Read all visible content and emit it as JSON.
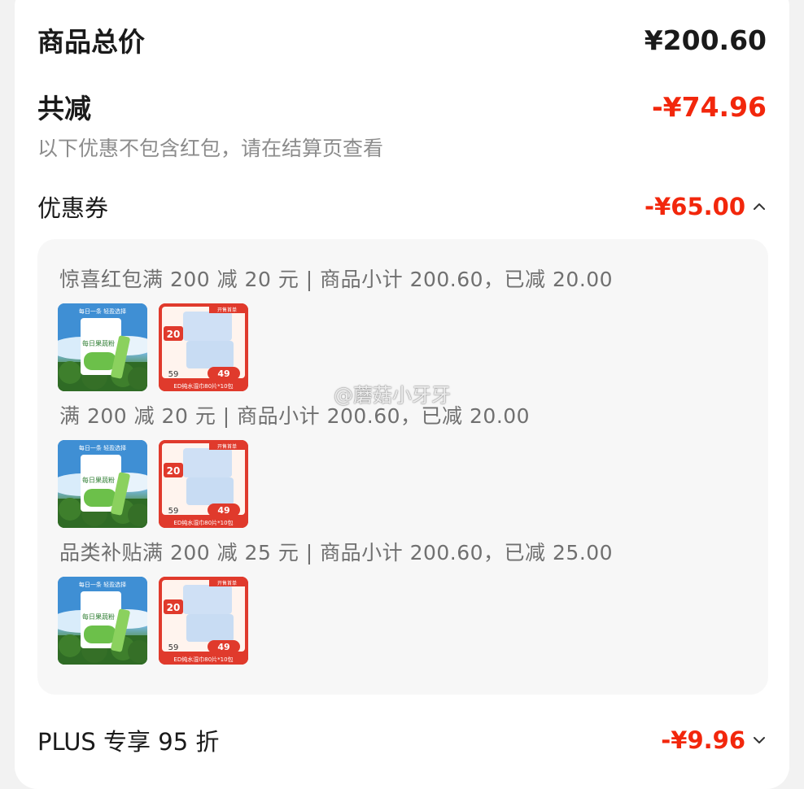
{
  "summary": {
    "total_label": "商品总价",
    "total_value": "¥200.60",
    "discount_label": "共减",
    "discount_value": "-¥74.96",
    "note": "以下优惠不包含红包，请在结算页查看"
  },
  "coupon_section": {
    "label": "优惠券",
    "value": "-¥65.00",
    "expanded_icon": "chevron-up-icon"
  },
  "coupons": [
    {
      "text": "惊喜红包满 200 减 20 元 | 商品小计 200.60，已减 20.00"
    },
    {
      "text": "满 200 减 20 元 | 商品小计 200.60，已减 20.00"
    },
    {
      "text": "品类补贴满 200 减 25 元 | 商品小计 200.60，已减 25.00"
    }
  ],
  "product_images": {
    "item1": {
      "top_text": "每日一条 轻盈选择",
      "bottom_text": "每日果蔬粉"
    },
    "item2": {
      "corner_tag": "开售首单",
      "big_number": "20",
      "price_old": "59",
      "price_new": "49",
      "footer": "ED纯水湿巾80片*10包"
    }
  },
  "watermark": "@蘑菇小牙牙",
  "plus_section": {
    "label": "PLUS 专享 95 折",
    "value": "-¥9.96",
    "collapsed_icon": "chevron-down-icon"
  },
  "colors": {
    "accent_red": "#f2270c",
    "panel_bg": "#f7f7f7",
    "muted_text": "#8c8c8c"
  }
}
